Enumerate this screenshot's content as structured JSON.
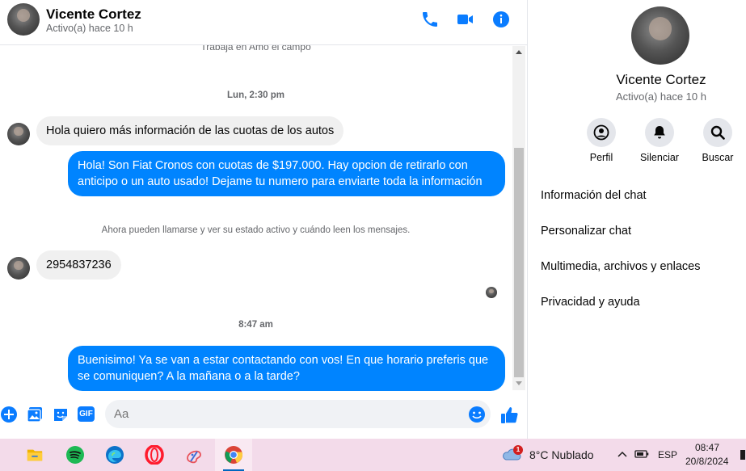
{
  "header": {
    "name": "Vicente Cortez",
    "status": "Activo(a) hace 10 h",
    "icons": [
      "phone-icon",
      "video-camera-icon",
      "info-icon"
    ]
  },
  "conversation": {
    "top_note": "Trabaja en Amo el campo",
    "timestamp_1": "Lun, 2:30 pm",
    "msg_1": "Hola quiero más información de las cuotas de los autos",
    "msg_2": "Hola! Son Fiat Cronos con cuotas de $197.000. Hay opcion de retirarlo con anticipo o un auto usado! Dejame tu numero para enviarte toda la información",
    "system_note": "Ahora pueden llamarse y ver su estado activo y cuándo leen los mensajes.",
    "msg_3": "2954837236",
    "timestamp_2": "8:47 am",
    "msg_4": "Buenisimo! Ya se van a estar contactando con vos! En que horario preferis que se comuniquen? A la mañana o a la tarde?"
  },
  "composer": {
    "placeholder": "Aa",
    "icons": [
      "plus-icon",
      "image-icon",
      "sticker-icon",
      "gif-icon",
      "emoji-icon",
      "like-icon"
    ],
    "gif_label": "GIF"
  },
  "panel": {
    "name": "Vicente Cortez",
    "status": "Activo(a) hace 10 h",
    "actions": [
      {
        "label": "Perfil",
        "icon": "profile-icon"
      },
      {
        "label": "Silenciar",
        "icon": "bell-icon"
      },
      {
        "label": "Buscar",
        "icon": "search-icon"
      }
    ],
    "menu": [
      "Información del chat",
      "Personalizar chat",
      "Multimedia, archivos y enlaces",
      "Privacidad y ayuda"
    ]
  },
  "taskbar": {
    "apps": [
      "file-explorer-icon",
      "spotify-icon",
      "edge-icon",
      "opera-icon",
      "paint-icon",
      "chrome-icon"
    ],
    "weather_badge": "1",
    "weather_text": "8°C  Nublado",
    "language": "ESP",
    "time": "08:47",
    "date": "20/8/2024"
  },
  "colors": {
    "messenger_blue": "#0084ff",
    "icon_blue": "#0a7cff",
    "taskbar_bg": "#f3dbea"
  }
}
